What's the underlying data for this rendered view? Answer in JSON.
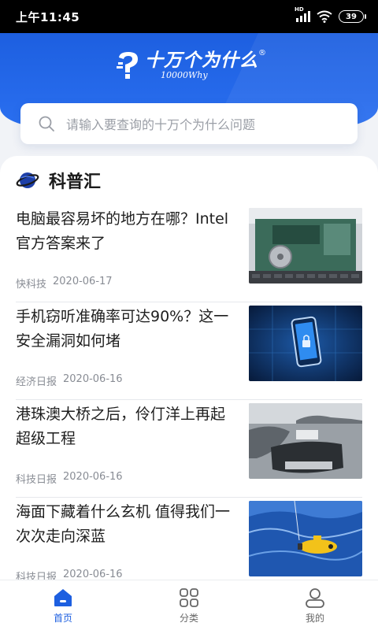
{
  "status_bar": {
    "time": "上午11:45",
    "network": "HD",
    "battery": "39"
  },
  "header": {
    "logo_cn": "十万个为什么",
    "logo_en": "10000Why",
    "logo_reg": "®"
  },
  "search": {
    "placeholder": "请输入要查询的十万个为什么问题"
  },
  "section": {
    "title": "科普汇"
  },
  "news": [
    {
      "title": "电脑最容易坏的地方在哪？Intel官方答案来了",
      "source": "快科技",
      "date": "2020-06-17",
      "thumb": "motherboard"
    },
    {
      "title": "手机窃听准确率可达90%？这一安全漏洞如何堵",
      "source": "经济日报",
      "date": "2020-06-16",
      "thumb": "phone-lock"
    },
    {
      "title": "港珠澳大桥之后，伶仃洋上再起超级工程",
      "source": "科技日报",
      "date": "2020-06-16",
      "thumb": "island-aerial"
    },
    {
      "title": "海面下藏着什么玄机 值得我们一次次走向深蓝",
      "source": "科技日报",
      "date": "2020-06-16",
      "thumb": "ocean-sub"
    }
  ],
  "tabs": [
    {
      "label": "首页",
      "icon": "home-icon",
      "active": true
    },
    {
      "label": "分类",
      "icon": "category-icon",
      "active": false
    },
    {
      "label": "我的",
      "icon": "profile-icon",
      "active": false
    }
  ],
  "colors": {
    "primary": "#1d5fe0",
    "text": "#1e1e1e",
    "meta": "#888c94"
  }
}
